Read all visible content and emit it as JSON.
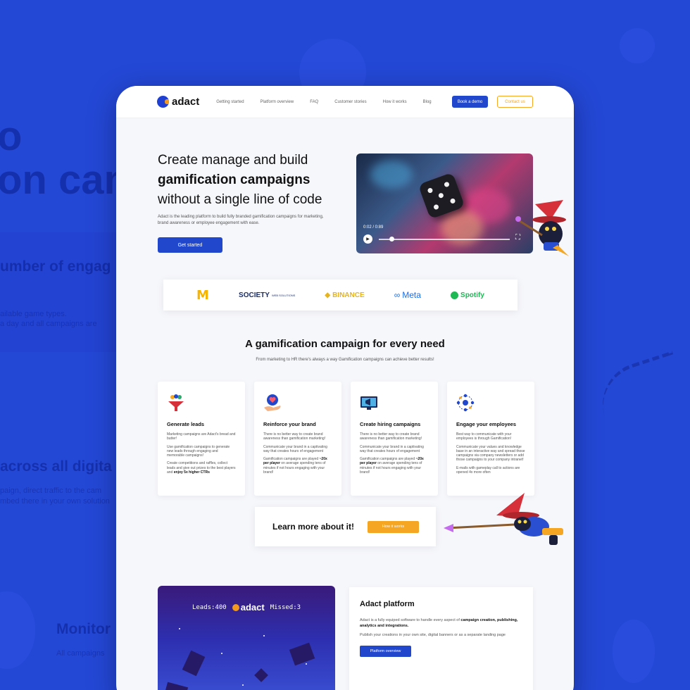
{
  "background": {
    "big_text": "on cam",
    "big_text_o": "o",
    "heading_1": "umber of engag",
    "small_1": "ailable game types.",
    "small_2": "a day and all campaigns are",
    "heading_2": "across all digita",
    "small_3": "paign, direct traffic to the cam",
    "small_4": "mbed there in your own solution",
    "heading_3": "Monitor",
    "small_5": "All campaigns"
  },
  "header": {
    "logo_text": "adact",
    "nav": [
      "Getting started",
      "Platform overview",
      "FAQ",
      "Customer stories",
      "How it works",
      "Blog"
    ],
    "book_demo": "Book a demo",
    "contact_us": "Contact us"
  },
  "hero": {
    "line1": "Create manage and build",
    "line2": "gamification campaigns",
    "line3": "without a single line of code",
    "description": "Adact is the leading platform to build fully branded gamification campaigns for marketing, brand awareness or employee engagement with ease.",
    "cta": "Get started",
    "video_time": "0:02 / 0:89",
    "video_progress": 0.1
  },
  "partners": {
    "mcdonalds": "M",
    "society": "SOCIETY",
    "society_sub": "WEB SOLUTIONS",
    "binance": "BINANCE",
    "meta": "Meta",
    "spotify": "Spotify"
  },
  "section": {
    "title": "A gamification campaign for every need",
    "subtitle": "From marketing to HR there's always a way Gamification campaigns can achieve better results!"
  },
  "cards": [
    {
      "title": "Generate leads",
      "p1": "Marketing campaigns are Adact's bread and butter!",
      "p2": "Use gamification campaigns to generate new leads through engaging and memorable campaigns!",
      "p3_pre": "Create competitions and raffles, collect leads and give out prizes to the best players and ",
      "p3_bold": "enjoy 5x higher CTRs",
      "p3_post": ""
    },
    {
      "title": "Reinforce your brand",
      "p1": "There is no better way to create brand awareness than gamification marketing!",
      "p2": "Communicate your brand in a captivating way that creates hours of engagement",
      "p3_pre": "Gamification campaigns are played ",
      "p3_bold": "~20x per player",
      "p3_post": " on average spending tens of minutes if not hours engaging with your brand!"
    },
    {
      "title": "Create hiring campaigns",
      "p1": "There is no better way to create brand awareness than gamification marketing!",
      "p2": "Communicate your brand in a captivating way that creates hours of engagement",
      "p3_pre": "Gamification campaigns are played ",
      "p3_bold": "~20x per player",
      "p3_post": " on average spending tens of minutes if not hours engaging with your brand!"
    },
    {
      "title": "Engage your employees",
      "p1": "Best way to communicate with your employees is through Gamification!",
      "p2": "Communicate your values and knowledge base in an interactive way and spread those campaigns via company newsletters or add those campaigns to your company intranet!",
      "p3_pre": "E-mails with gameplay call to actions are opened 4x more often",
      "p3_bold": "",
      "p3_post": ""
    }
  ],
  "learn_more": {
    "text": "Learn more about it!",
    "button": "How it works"
  },
  "game": {
    "leads": "Leads:400",
    "logo": "adact",
    "missed": "Missed:3"
  },
  "platform": {
    "title": "Adact platform",
    "p1_pre": "Adact is a fully equiped software to handle every aspect of ",
    "p1_bold": "campaign creation, publishing, analytics and integrations.",
    "p2": "Publish your creations in your own site, digital banners or as a separate landing page",
    "button": "Platform overview"
  },
  "colors": {
    "brand_blue": "#2148cc",
    "accent_orange": "#f5a623",
    "background_blue": "#2448d6"
  }
}
